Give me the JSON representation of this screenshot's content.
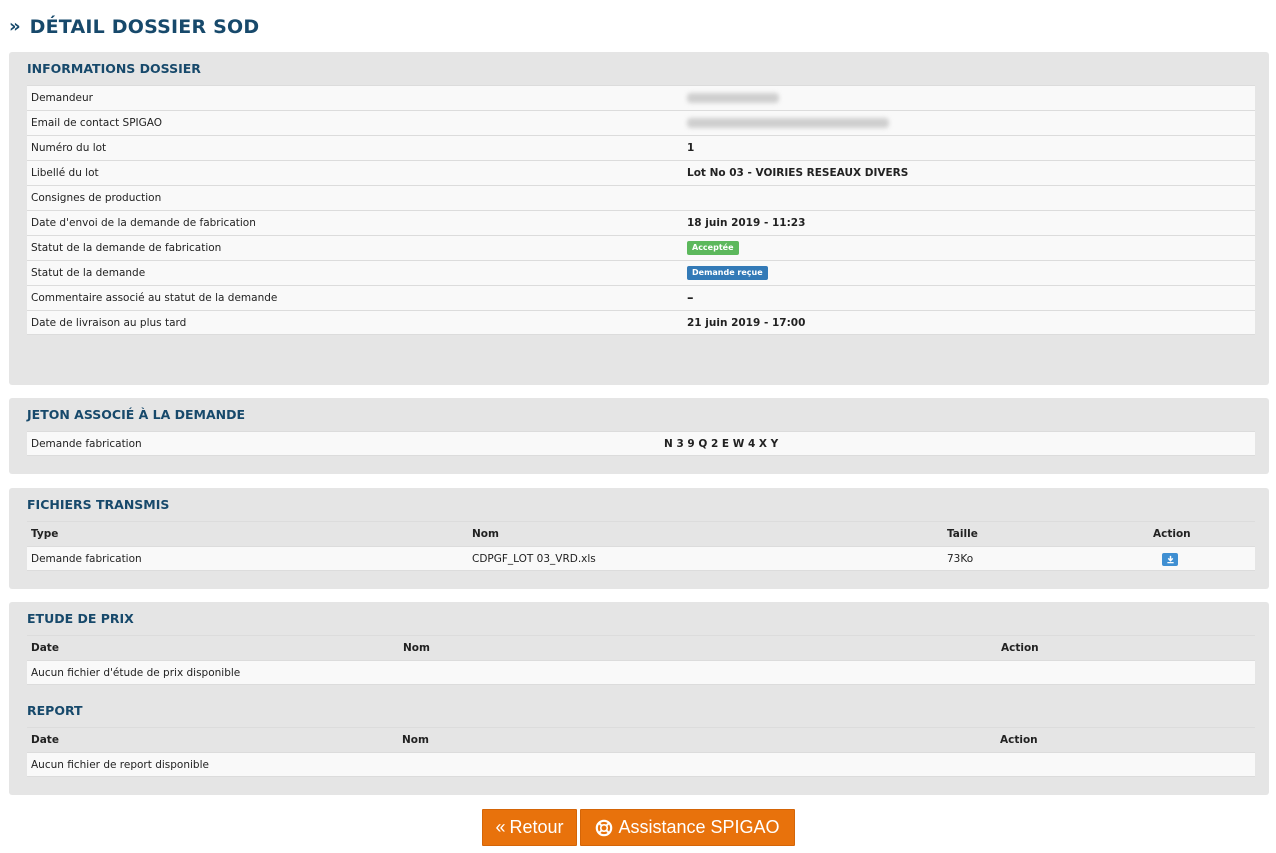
{
  "page": {
    "title": "DÉTAIL DOSSIER SOD"
  },
  "informations": {
    "title": "INFORMATIONS DOSSIER",
    "rows": [
      {
        "label": "Demandeur",
        "value": ""
      },
      {
        "label": "Email de contact SPIGAO",
        "value": ""
      },
      {
        "label": "Numéro du lot",
        "value": "1"
      },
      {
        "label": "Libellé du lot",
        "value": "Lot No 03 - VOIRIES RESEAUX DIVERS"
      },
      {
        "label": "Consignes de production",
        "value": ""
      },
      {
        "label": "Date d'envoi de la demande de fabrication",
        "value": "18 juin 2019 - 11:23"
      },
      {
        "label": "Statut de la demande de fabrication",
        "value": "Acceptée"
      },
      {
        "label": "Statut de la demande",
        "value": "Demande reçue"
      },
      {
        "label": "Commentaire associé au statut de la demande",
        "value": "–"
      },
      {
        "label": "Date de livraison au plus tard",
        "value": "21 juin 2019 - 17:00"
      }
    ],
    "colors": {
      "accepted": "#5cb85c",
      "received": "#337ab7"
    }
  },
  "jeton": {
    "title": "JETON ASSOCIÉ À LA DEMANDE",
    "label": "Demande fabrication",
    "value": "N 3 9 Q 2 E W 4 X Y"
  },
  "fichiers": {
    "title": "FICHIERS TRANSMIS",
    "headers": {
      "type": "Type",
      "nom": "Nom",
      "taille": "Taille",
      "action": "Action"
    },
    "rows": [
      {
        "type": "Demande fabrication",
        "nom": "CDPGF_LOT 03_VRD.xls",
        "taille": "73Ko",
        "action_icon": "download-icon"
      }
    ]
  },
  "etude": {
    "title": "ETUDE DE PRIX",
    "headers": {
      "date": "Date",
      "nom": "Nom",
      "action": "Action"
    },
    "empty": "Aucun fichier d'étude de prix disponible"
  },
  "report": {
    "title": "REPORT",
    "headers": {
      "date": "Date",
      "nom": "Nom",
      "action": "Action"
    },
    "empty": "Aucun fichier de report disponible"
  },
  "buttons": {
    "retour": "Retour",
    "assistance": "Assistance SPIGAO",
    "accent": "#e8720c"
  }
}
